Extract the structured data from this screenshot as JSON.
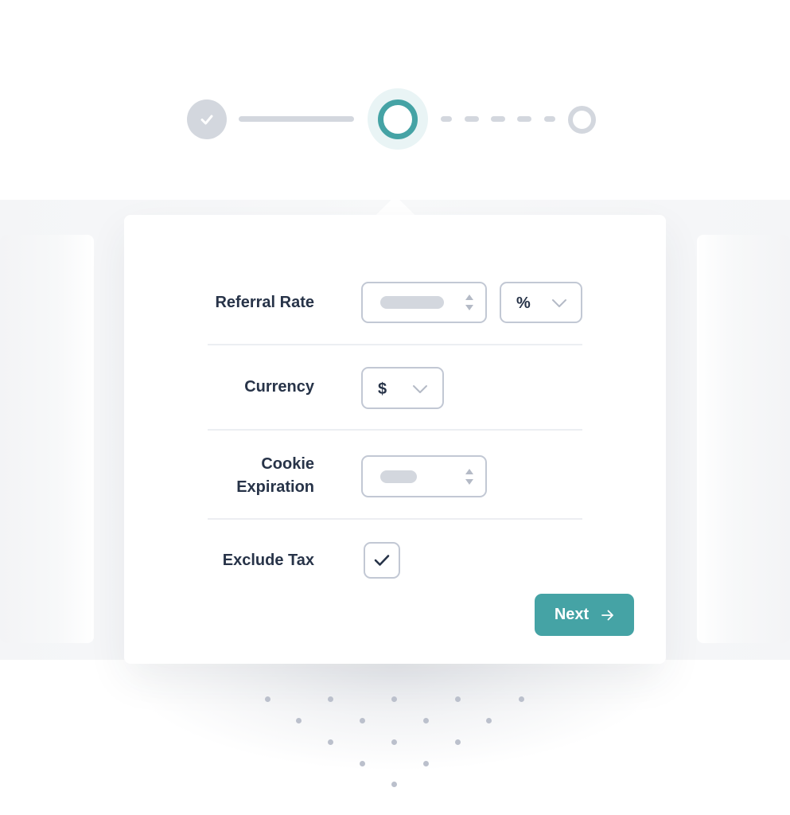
{
  "stepper": {
    "steps": [
      {
        "name": "step-1",
        "state": "complete"
      },
      {
        "name": "step-2",
        "state": "current"
      },
      {
        "name": "step-3",
        "state": "upcoming"
      }
    ],
    "current_step": 2,
    "total_steps": 3
  },
  "form": {
    "referral_rate": {
      "label": "Referral Rate",
      "value": "",
      "unit": "%"
    },
    "currency": {
      "label": "Currency",
      "value": "$"
    },
    "cookie_expiration": {
      "label_line1": "Cookie",
      "label_line2": "Expiration",
      "value": ""
    },
    "exclude_tax": {
      "label": "Exclude Tax",
      "checked": true
    }
  },
  "actions": {
    "next_label": "Next",
    "next_icon": "arrow-right-icon"
  },
  "colors": {
    "accent": "#45a3a5",
    "text": "#273348",
    "border": "#c2c8d4",
    "muted": "#d3d7de"
  }
}
